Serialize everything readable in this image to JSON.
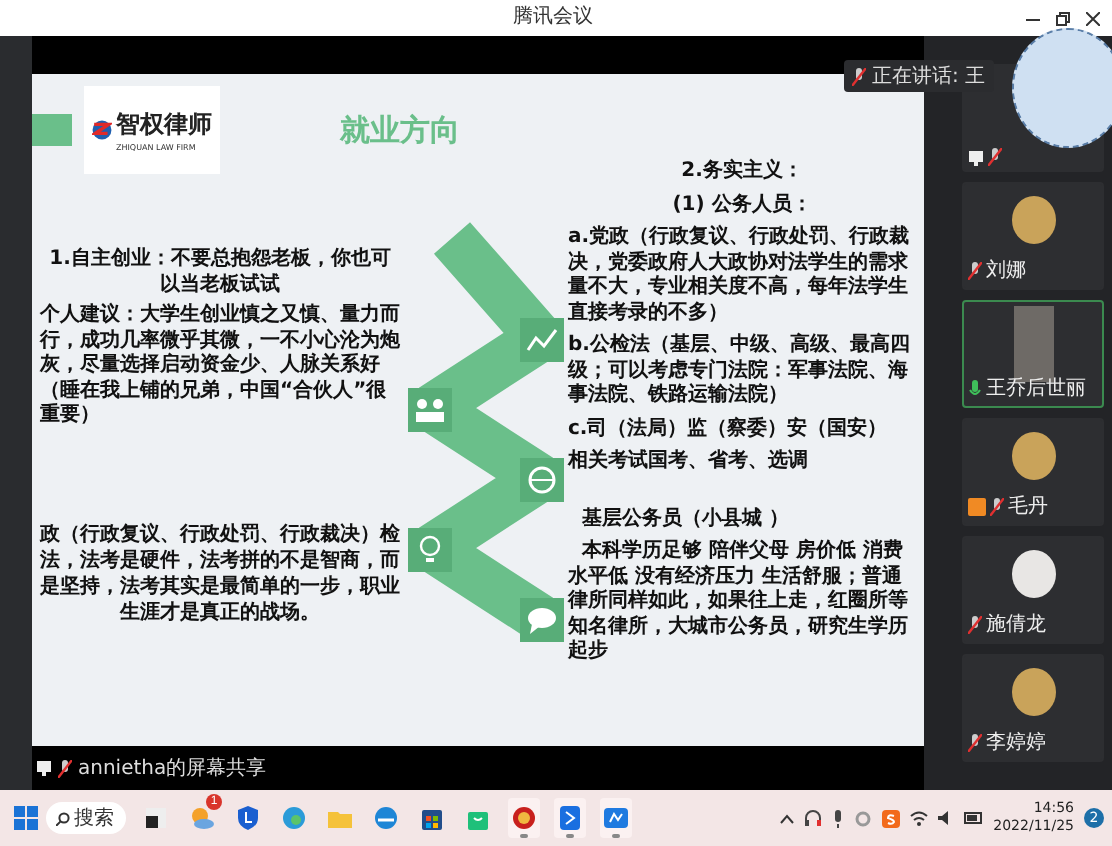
{
  "window": {
    "title": "腾讯会议"
  },
  "slide": {
    "logo": {
      "name": "智权律师",
      "subtitle": "ZHIQUAN LAW FIRM"
    },
    "title": "就业方向",
    "left_blocks": [
      {
        "kind": "heading",
        "text": "1.自主创业：不要总抱怨老板，你也可以当老板试试"
      },
      {
        "kind": "body",
        "text": "个人建议：大学生创业慎之又慎、量力而行，成功几率微乎其微，一不小心沦为炮灰，尽量选择启动资金少、人脉关系好（睡在我上铺的兄弟，中国“合伙人”很重要）"
      },
      {
        "kind": "gap"
      },
      {
        "kind": "heading",
        "text": "政（行政复议、行政处罚、行政裁决）检法，法考是硬件，法考拼的不是智商，而是坚持，法考其实是最简单的一步，职业生涯才是真正的战场。"
      }
    ],
    "right_blocks": [
      {
        "kind": "center",
        "text": "2.务实主义："
      },
      {
        "kind": "center",
        "text": "(1) 公务人员："
      },
      {
        "kind": "body",
        "text": "a.党政（行政复议、行政处罚、行政裁决，党委政府人大政协对法学生的需求量不大，专业相关度不高，每年法学生直接考录的不多）"
      },
      {
        "kind": "body",
        "text": "b.公检法（基层、中级、高级、最高四级；可以考虑专门法院：军事法院、海事法院、铁路运输法院）"
      },
      {
        "kind": "body",
        "text": "c.司（法局）监（察委）安（国安）"
      },
      {
        "kind": "body",
        "text": "相关考试国考、省考、选调"
      },
      {
        "kind": "gap"
      },
      {
        "kind": "body",
        "text": "  基层公务员（小县城 ）"
      },
      {
        "kind": "body",
        "text": "  本科学历足够 陪伴父母 房价低 消费水平低 没有经济压力 生活舒服；普通律所同样如此，如果往上走，红圈所等知名律所，大城市公务员，研究生学历起步"
      }
    ]
  },
  "share_label": "annietha的屏幕共享",
  "speaking": "正在讲话: 王",
  "participants": [
    {
      "kind": "sharing",
      "speaking": false,
      "host": false
    },
    {
      "kind": "photo",
      "name": "刘娜",
      "speaking": false,
      "host": false
    },
    {
      "kind": "video",
      "name": "王乔后世丽",
      "speaking": true,
      "host": false
    },
    {
      "kind": "photo",
      "name": "毛丹",
      "speaking": false,
      "host": true
    },
    {
      "kind": "drawing",
      "name": "施倩龙",
      "speaking": false,
      "host": false
    },
    {
      "kind": "photo",
      "name": "李婷婷",
      "speaking": false,
      "host": false
    }
  ],
  "taskbar": {
    "search": "搜索",
    "apps": [
      {
        "kind": "tile",
        "running": false
      },
      {
        "kind": "weather",
        "running": false,
        "badge": "1"
      },
      {
        "kind": "shield",
        "running": false
      },
      {
        "kind": "edge",
        "running": false
      },
      {
        "kind": "folder",
        "running": false
      },
      {
        "kind": "browser",
        "running": false
      },
      {
        "kind": "store",
        "running": false
      },
      {
        "kind": "bag",
        "running": false
      },
      {
        "kind": "seal",
        "running": true
      },
      {
        "kind": "pen",
        "running": true
      },
      {
        "kind": "meeting",
        "running": true
      }
    ],
    "time": "14:56",
    "date": "2022/11/25",
    "notifications": "2"
  }
}
